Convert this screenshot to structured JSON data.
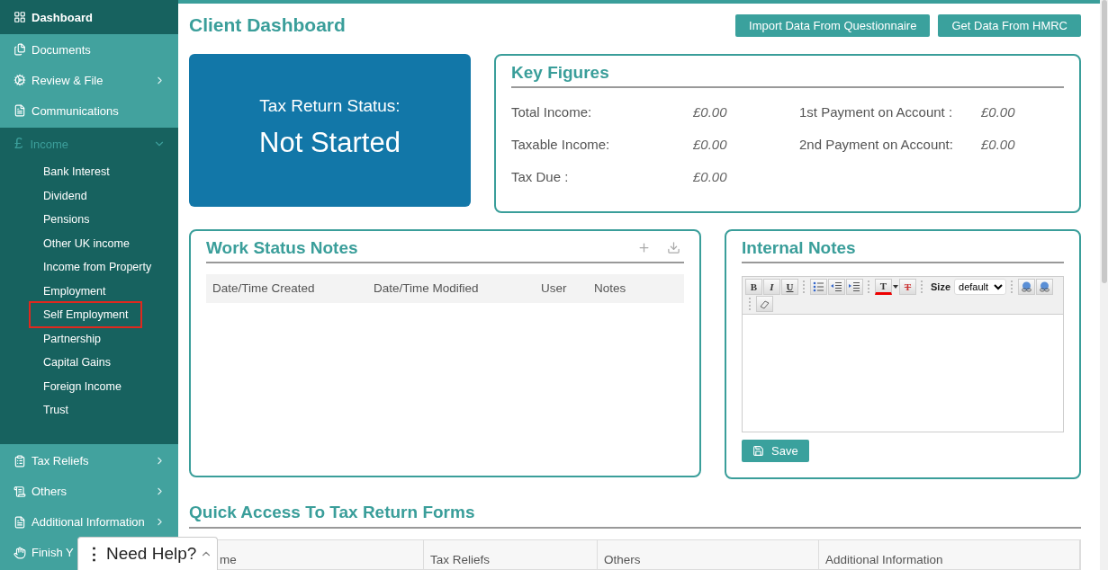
{
  "sidebar": {
    "items": [
      {
        "label": "Dashboard",
        "selected": true,
        "has_arrow": false
      },
      {
        "label": "Documents",
        "selected": false,
        "has_arrow": false
      },
      {
        "label": "Review & File",
        "selected": false,
        "has_arrow": true
      },
      {
        "label": "Communications",
        "selected": false,
        "has_arrow": false
      },
      {
        "label": "Income",
        "icon_text": "£",
        "selected": false,
        "has_arrow": true,
        "expanded": true,
        "children": [
          {
            "label": "Bank Interest",
            "highlighted": false
          },
          {
            "label": "Dividend",
            "highlighted": false
          },
          {
            "label": "Pensions",
            "highlighted": false
          },
          {
            "label": "Other UK income",
            "highlighted": false
          },
          {
            "label": "Income from Property",
            "highlighted": false
          },
          {
            "label": "Employment",
            "highlighted": false
          },
          {
            "label": "Self Employment",
            "highlighted": true
          },
          {
            "label": "Partnership",
            "highlighted": false
          },
          {
            "label": "Capital Gains",
            "highlighted": false
          },
          {
            "label": "Foreign Income",
            "highlighted": false
          },
          {
            "label": "Trust",
            "highlighted": false
          }
        ]
      },
      {
        "label": "Tax Reliefs",
        "selected": false,
        "has_arrow": true
      },
      {
        "label": "Others",
        "selected": false,
        "has_arrow": true
      },
      {
        "label": "Additional Information",
        "selected": false,
        "has_arrow": true
      },
      {
        "label": "Finish Y",
        "selected": false,
        "has_arrow": false
      }
    ]
  },
  "header": {
    "title": "Client Dashboard",
    "buttons": [
      "Import Data From Questionnaire",
      "Get Data From HMRC"
    ]
  },
  "status_card": {
    "label": "Tax Return Status:",
    "value": "Not Started"
  },
  "key_figures": {
    "title": "Key Figures",
    "items": [
      {
        "label": "Total Income:",
        "value": "£0.00"
      },
      {
        "label": "1st Payment on Account :",
        "value": "£0.00"
      },
      {
        "label": "Taxable Income:",
        "value": "£0.00"
      },
      {
        "label": "2nd Payment on Account:",
        "value": "£0.00"
      },
      {
        "label": "Tax Due :",
        "value": "£0.00"
      }
    ]
  },
  "work_status_notes": {
    "title": "Work Status Notes",
    "columns": [
      "Date/Time Created",
      "Date/Time Modified",
      "User",
      "Notes"
    ]
  },
  "internal_notes": {
    "title": "Internal Notes",
    "toolbar": [
      {
        "kind": "bold",
        "label": "B"
      },
      {
        "kind": "italic",
        "label": "I"
      },
      {
        "kind": "underline",
        "label": "U"
      },
      {
        "kind": "sep"
      },
      {
        "kind": "bullets"
      },
      {
        "kind": "outdent"
      },
      {
        "kind": "indent"
      },
      {
        "kind": "sep"
      },
      {
        "kind": "color",
        "label": "T"
      },
      {
        "kind": "clear",
        "label": "T"
      },
      {
        "kind": "sep"
      },
      {
        "kind": "size",
        "label": "Size",
        "value": "default"
      },
      {
        "kind": "sep"
      },
      {
        "kind": "link"
      },
      {
        "kind": "unlink"
      },
      {
        "kind": "sep"
      },
      {
        "kind": "eraser"
      }
    ],
    "save_label": "Save"
  },
  "quick_access": {
    "title": "Quick Access To Tax Return Forms",
    "columns": [
      "me",
      "Tax Reliefs",
      "Others",
      "Additional Information"
    ]
  },
  "help_popup": {
    "handle": "⋮",
    "label": "Need Help?"
  }
}
